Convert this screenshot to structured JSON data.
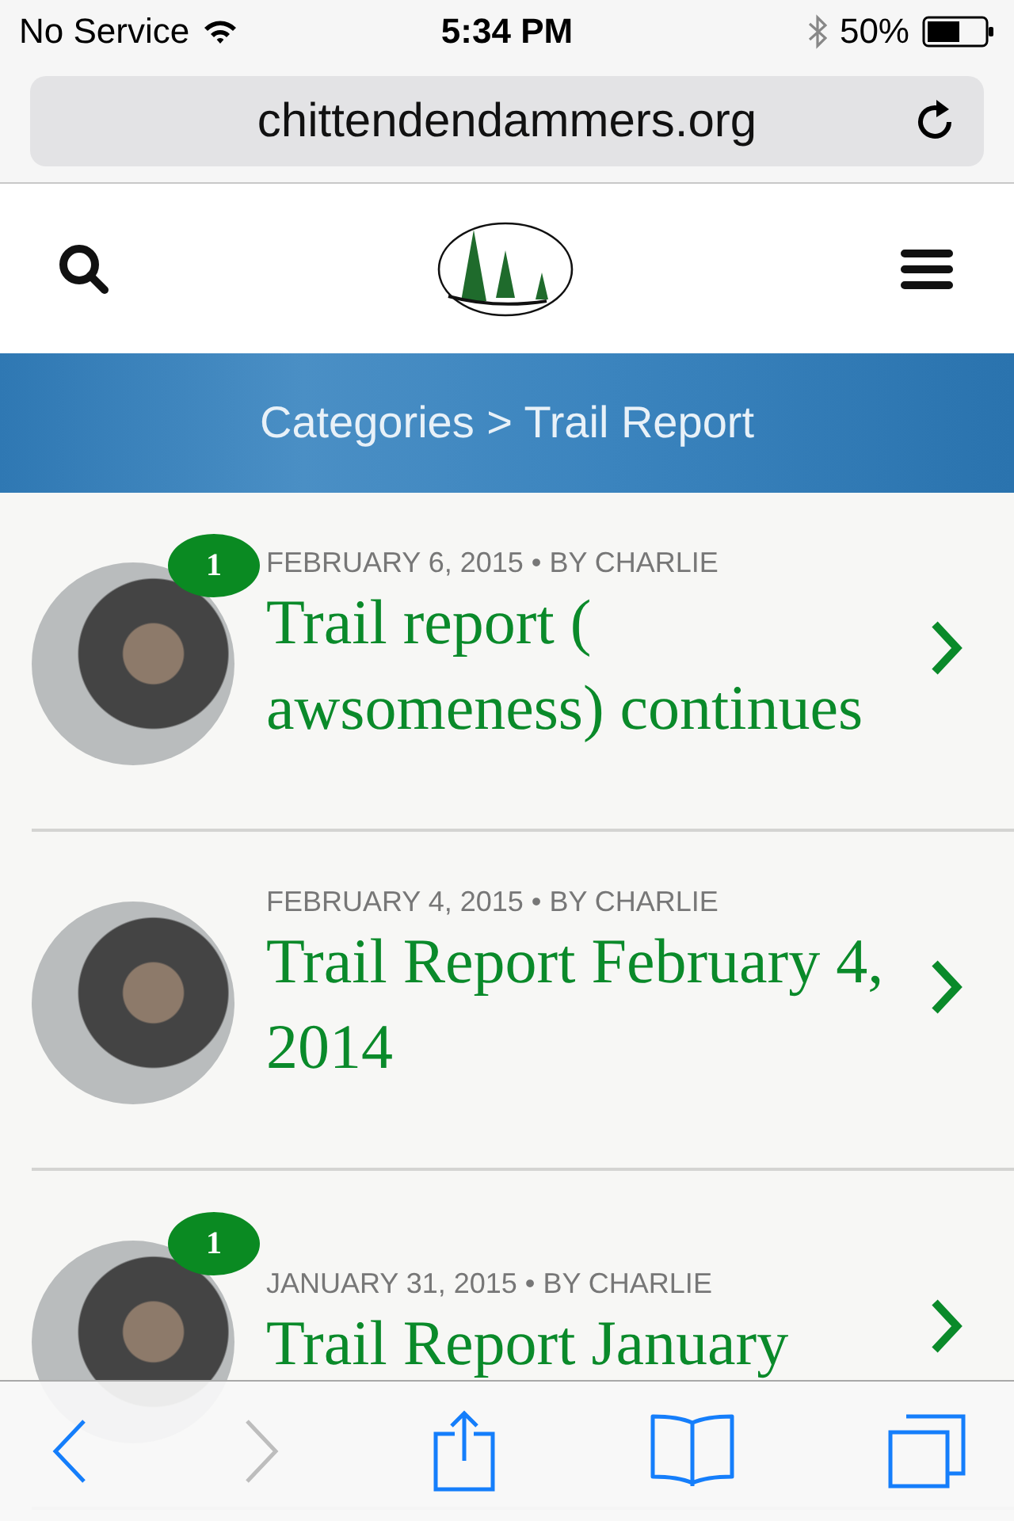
{
  "status_bar": {
    "carrier": "No Service",
    "time": "5:34 PM",
    "battery": "50%"
  },
  "address_bar": {
    "url": "chittendendammers.org"
  },
  "banner": {
    "text": "Categories > Trail Report"
  },
  "posts": [
    {
      "meta": "FEBRUARY 6, 2015 • BY CHARLIE",
      "title": "Trail report ( awsomeness) continues",
      "comments": "1"
    },
    {
      "meta": "FEBRUARY 4, 2015 • BY CHARLIE",
      "title": "Trail Report February 4, 2014"
    },
    {
      "meta": "JANUARY 31, 2015 • BY CHARLIE",
      "title": "Trail Report January",
      "comments": "1"
    }
  ],
  "toolbar": {
    "back_enabled": true,
    "forward_enabled": false
  }
}
